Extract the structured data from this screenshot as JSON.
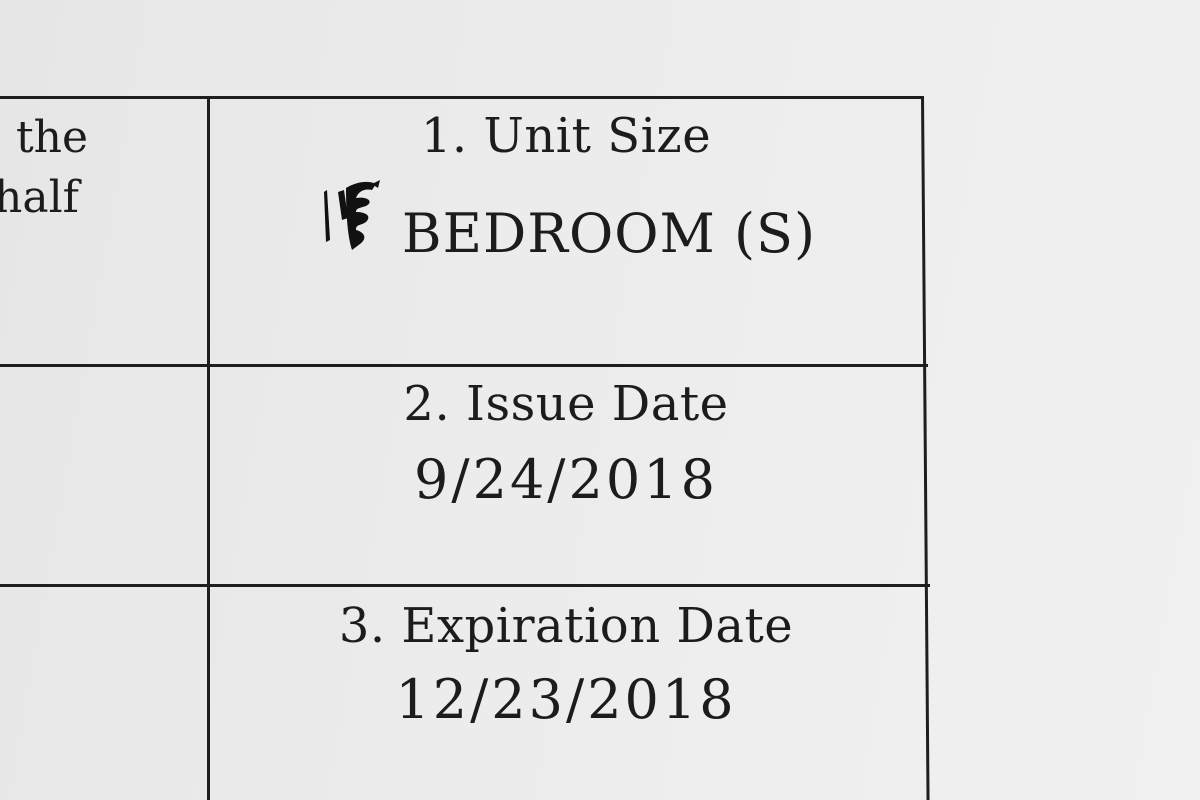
{
  "left_column": {
    "line_1": "the",
    "line_2": "half"
  },
  "rows": [
    {
      "label": "1. Unit Size",
      "value": "BEDROOM (S)",
      "handwritten_value": "1"
    },
    {
      "label": "2. Issue Date",
      "value": "9/24/2018"
    },
    {
      "label": "3. Expiration Date",
      "value": "12/23/2018"
    }
  ]
}
